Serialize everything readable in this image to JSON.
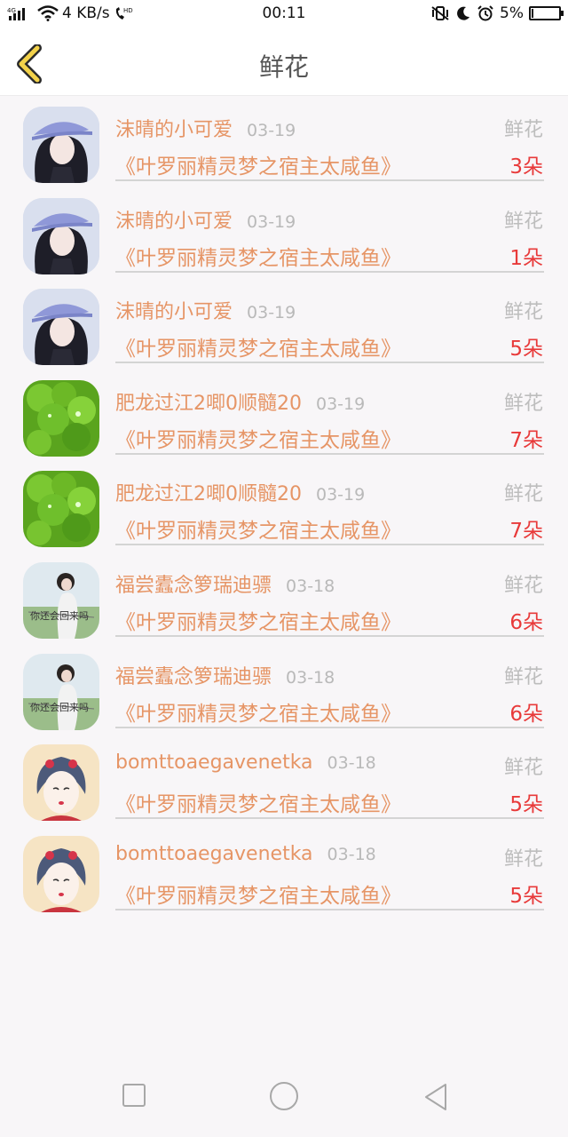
{
  "status": {
    "network": "4G",
    "speed": "4 KB/s",
    "time": "00:11",
    "battery": "5%",
    "battery_level": 0.05
  },
  "header": {
    "title": "鲜花"
  },
  "gifts": [
    {
      "name": "沫晴的小可爱",
      "date": "03-19",
      "type": "鲜花",
      "book": "《叶罗丽精灵梦之宿主太咸鱼》",
      "count": "3朵",
      "avatar": "girl-cap"
    },
    {
      "name": "沫晴的小可爱",
      "date": "03-19",
      "type": "鲜花",
      "book": "《叶罗丽精灵梦之宿主太咸鱼》",
      "count": "1朵",
      "avatar": "girl-cap"
    },
    {
      "name": "沫晴的小可爱",
      "date": "03-19",
      "type": "鲜花",
      "book": "《叶罗丽精灵梦之宿主太咸鱼》",
      "count": "5朵",
      "avatar": "girl-cap"
    },
    {
      "name": "肥龙过江2唧0顺髓20",
      "date": "03-19",
      "type": "鲜花",
      "book": "《叶罗丽精灵梦之宿主太咸鱼》",
      "count": "7朵",
      "avatar": "clover"
    },
    {
      "name": "肥龙过江2唧0顺髓20",
      "date": "03-19",
      "type": "鲜花",
      "book": "《叶罗丽精灵梦之宿主太咸鱼》",
      "count": "7朵",
      "avatar": "clover"
    },
    {
      "name": "福尝蠹念箩瑞迪骠",
      "date": "03-18",
      "type": "鲜花",
      "book": "《叶罗丽精灵梦之宿主太咸鱼》",
      "count": "6朵",
      "avatar": "girl-outdoor"
    },
    {
      "name": "福尝蠹念箩瑞迪骠",
      "date": "03-18",
      "type": "鲜花",
      "book": "《叶罗丽精灵梦之宿主太咸鱼》",
      "count": "6朵",
      "avatar": "girl-outdoor"
    },
    {
      "name": "bomttoaegavenetka",
      "date": "03-18",
      "type": "鲜花",
      "book": "《叶罗丽精灵梦之宿主太咸鱼》",
      "count": "5朵",
      "avatar": "geisha"
    },
    {
      "name": "bomttoaegavenetka",
      "date": "03-18",
      "type": "鲜花",
      "book": "《叶罗丽精灵梦之宿主太咸鱼》",
      "count": "5朵",
      "avatar": "geisha"
    }
  ],
  "colors": {
    "accent": "#e69566",
    "count": "#e83a3a",
    "muted": "#b9b9b9",
    "back": "#f3d24a"
  },
  "nav": {
    "icons": [
      "square-icon",
      "circle-icon",
      "triangle-back-icon"
    ]
  }
}
